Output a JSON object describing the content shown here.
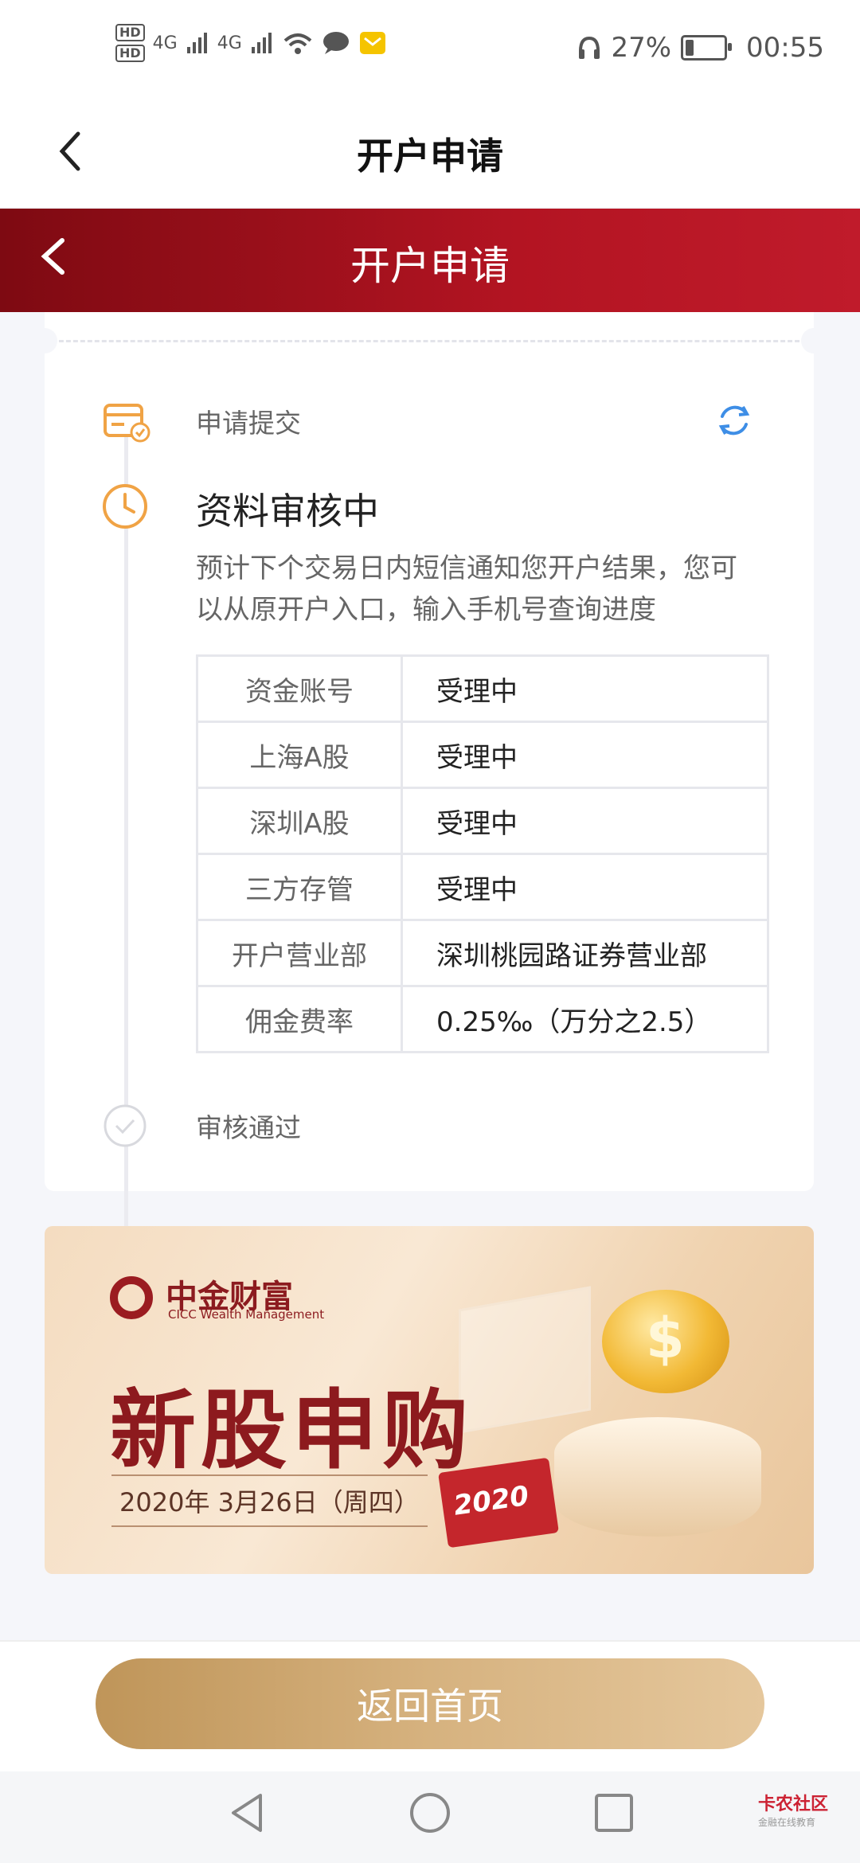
{
  "status_bar": {
    "hd1": "HD",
    "hd2": "HD",
    "net1": "4G",
    "net2": "4G",
    "battery_percent": "27%",
    "time": "00:55"
  },
  "header": {
    "title": "开户申请"
  },
  "red_header": {
    "title": "开户申请"
  },
  "progress": {
    "step1_label": "申请提交",
    "step2_title": "资料审核中",
    "step2_desc": "预计下个交易日内短信通知您开户结果，您可以从原开户入口，输入手机号查询进度",
    "step3_label": "审核通过"
  },
  "table": {
    "rows": [
      {
        "key": "资金账号",
        "value": "受理中"
      },
      {
        "key": "上海A股",
        "value": "受理中"
      },
      {
        "key": "深圳A股",
        "value": "受理中"
      },
      {
        "key": "三方存管",
        "value": "受理中"
      },
      {
        "key": "开户营业部",
        "value": "深圳桃园路证券营业部"
      },
      {
        "key": "佣金费率",
        "value": "0.25‰（万分之2.5）"
      }
    ]
  },
  "banner": {
    "brand": "中金财富",
    "brand_en": "CICC Wealth Management",
    "headline": "新股申购",
    "date": "2020年 3月26日（周四）",
    "calendar_year": "2020"
  },
  "footer": {
    "home_button": "返回首页"
  },
  "watermark": {
    "name": "卡农社区",
    "sub": "金融在线教育"
  },
  "colors": {
    "brand_red": "#9b1c21",
    "accent_orange": "#f0a345",
    "refresh_blue": "#3e8ee6",
    "button_gold": "#d6b27f"
  }
}
